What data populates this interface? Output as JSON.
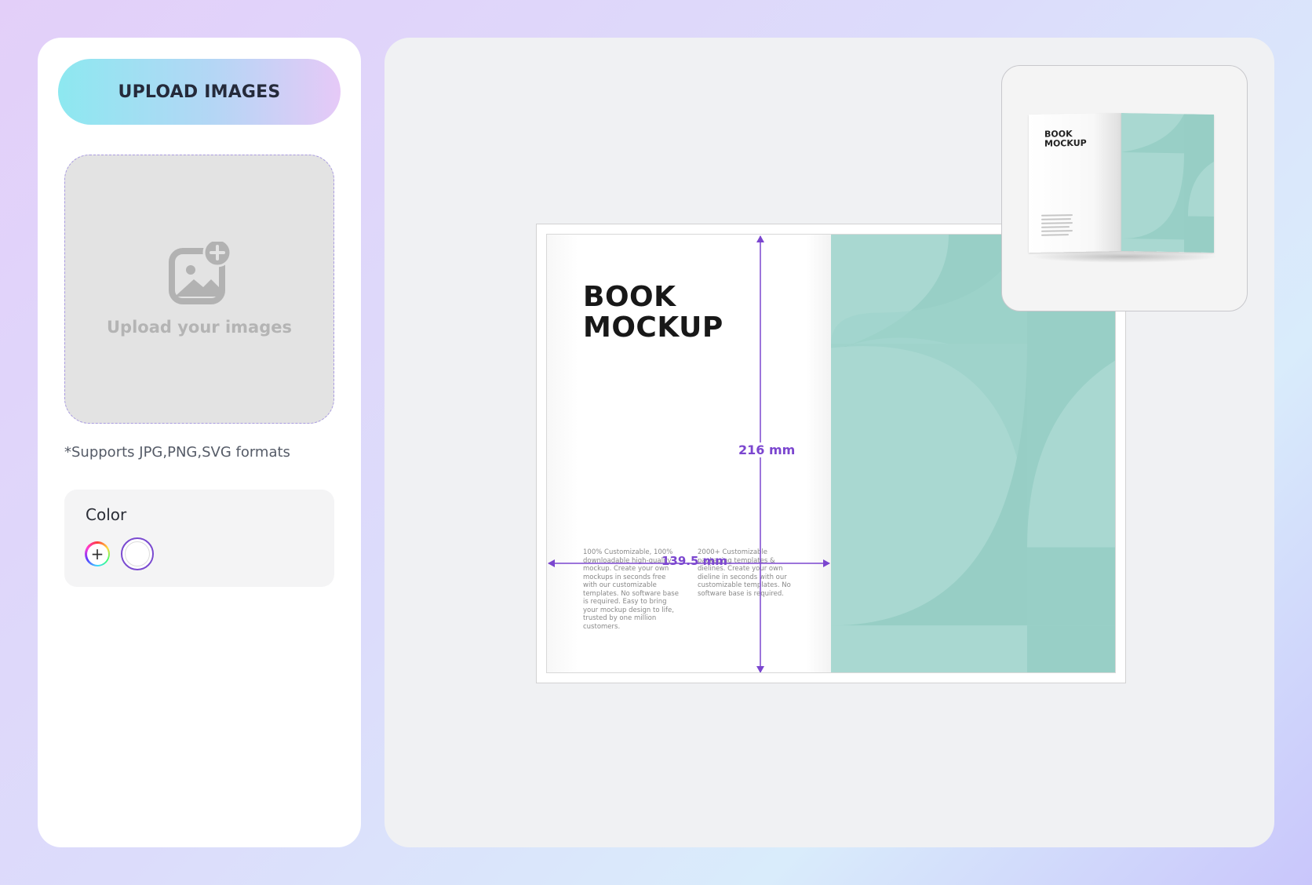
{
  "sidebar": {
    "upload_button_label": "UPLOAD IMAGES",
    "dropzone_label": "Upload your images",
    "formats_note": "*Supports JPG,PNG,SVG formats",
    "color_section": {
      "title": "Color",
      "add_button_symbol": "+",
      "selected_swatch": "#ffffff"
    }
  },
  "canvas": {
    "book": {
      "title_line1": "BOOK",
      "title_line2": "MOCKUP",
      "body_col1": "100% Customizable, 100% downloadable high-quality mockup. Create your own mockups in seconds free with our customizable templates. No software base is required. Easy to bring your mockup design to life, trusted by one million customers.",
      "body_col2": "2000+ Customizable packaging templates & dielines. Create your own dieline in seconds with our customizable templates. No software base is required.",
      "cover_color": "#a9d8d1",
      "dimension_height": "216 mm",
      "dimension_width": "139.5 mm",
      "dimension_color": "#7b46cf"
    },
    "preview": {
      "title_line1": "BOOK",
      "title_line2": "MOCKUP"
    }
  },
  "icons": [
    "image-add-icon",
    "plus-icon"
  ]
}
